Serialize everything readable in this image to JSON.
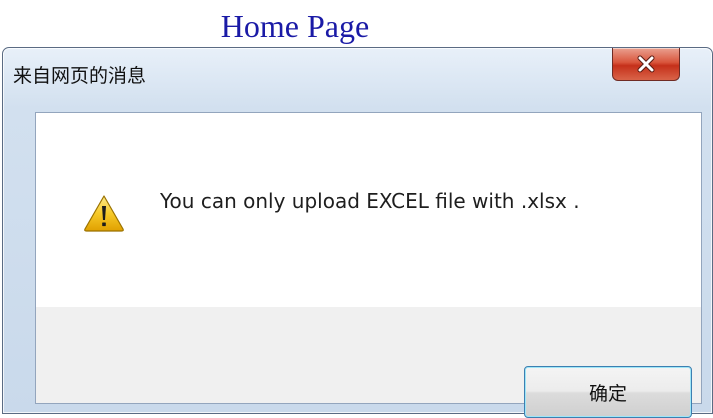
{
  "page": {
    "heading": "Home Page"
  },
  "dialog": {
    "title": "来自网页的消息",
    "close_icon": "close-icon",
    "message": "You can only upload EXCEL file with .xlsx .",
    "message_icon": "warning-icon",
    "ok_label": "确定"
  },
  "colors": {
    "heading_link": "#1a1aa6",
    "close_button": "#c7432b",
    "ok_button_border": "#3c7fb1",
    "warning_yellow": "#f4c20d"
  }
}
